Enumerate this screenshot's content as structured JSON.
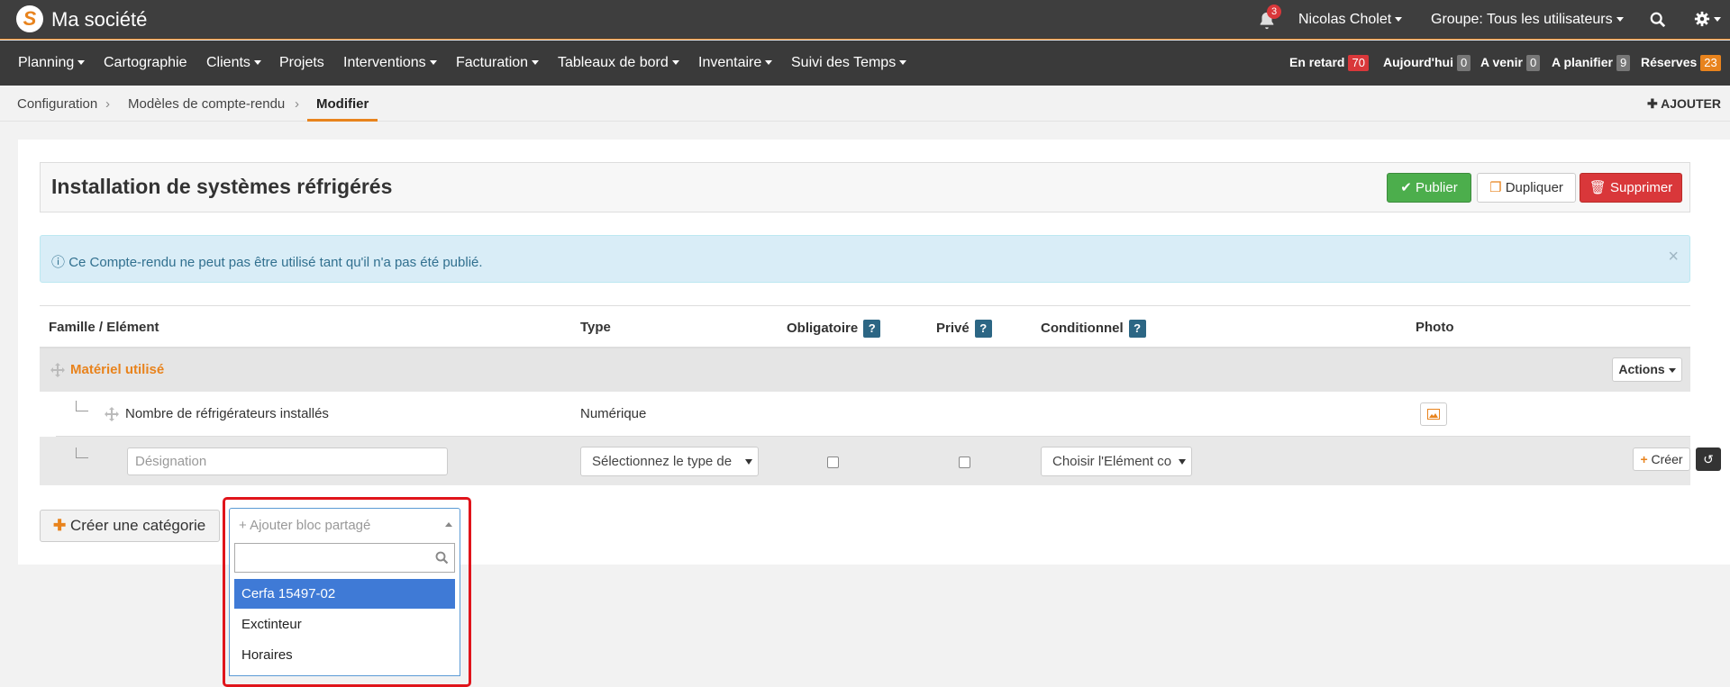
{
  "topbar": {
    "brand": "Ma société",
    "notifications_count": "3",
    "user": "Nicolas Cholet",
    "group": "Groupe: Tous les utilisateurs"
  },
  "nav": {
    "items": [
      "Planning",
      "Cartographie",
      "Clients",
      "Projets",
      "Interventions",
      "Facturation",
      "Tableaux de bord",
      "Inventaire",
      "Suivi des Temps"
    ],
    "stats": [
      {
        "label": "En retard",
        "count": "70",
        "color": "#d9373a"
      },
      {
        "label": "Aujourd'hui",
        "count": "0",
        "color": "#777777"
      },
      {
        "label": "A venir",
        "count": "0",
        "color": "#777777"
      },
      {
        "label": "A planifier",
        "count": "9",
        "color": "#777777"
      },
      {
        "label": "Réserves",
        "count": "23",
        "color": "#e8831d"
      }
    ]
  },
  "breadcrumb": {
    "items": [
      "Configuration",
      "Modèles de compte-rendu",
      "Modifier"
    ],
    "add_label": "AJOUTER"
  },
  "page": {
    "title": "Installation de systèmes réfrigérés",
    "publish_label": "Publier",
    "duplicate_label": "Dupliquer",
    "delete_label": "Supprimer",
    "alert": "Ce Compte-rendu ne peut pas être utilisé tant qu'il n'a pas été publié.",
    "alert_close": "×"
  },
  "table": {
    "headers": {
      "famille": "Famille / Elément",
      "type": "Type",
      "obligatoire": "Obligatoire",
      "prive": "Privé",
      "conditionnel": "Conditionnel",
      "photo": "Photo",
      "help": "?"
    },
    "category": {
      "name": "Matériel utilisé",
      "actions_label": "Actions"
    },
    "element": {
      "name": "Nombre de réfrigérateurs installés",
      "type": "Numérique"
    },
    "new_row": {
      "designation_placeholder": "Désignation",
      "type_select": "Sélectionnez le type de",
      "element_select": "Choisir l'Elément co",
      "create_label": "Créer"
    }
  },
  "footer": {
    "create_category_label": "Créer une catégorie"
  },
  "dropdown": {
    "placeholder": "+ Ajouter bloc partagé",
    "options": [
      "Cerfa 15497-02",
      "Exctinteur",
      "Horaires"
    ],
    "selected_index": 0
  },
  "colors": {
    "accent": "#e8831d",
    "topbar": "#3e3e3e",
    "highlight_box": "#e0141b"
  }
}
